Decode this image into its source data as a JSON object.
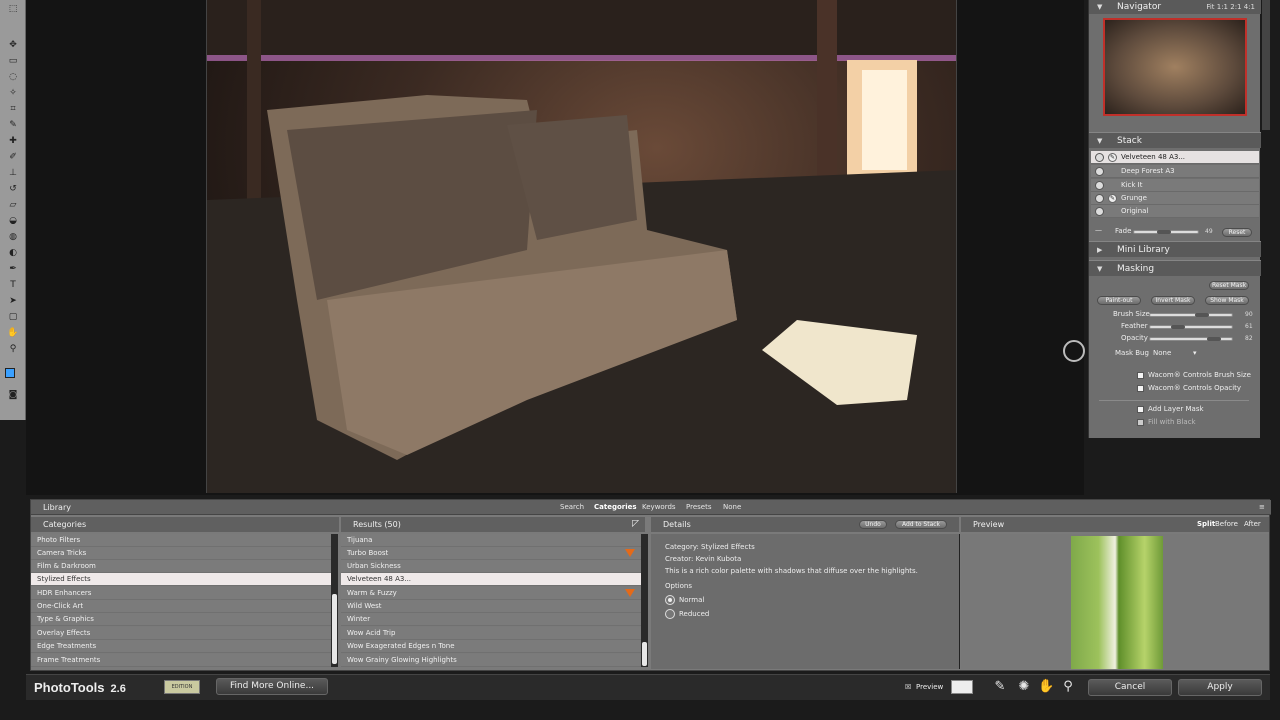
{
  "app": {
    "name": "PhotoTools",
    "version": "2.6",
    "edition_badge": "EDITION"
  },
  "navigator": {
    "title": "Navigator",
    "zoom_options": "Fit  1:1  2:1  4:1"
  },
  "stack": {
    "title": "Stack",
    "items": [
      {
        "label": "Velveteen 48 A3..."
      },
      {
        "label": "Deep Forest A3"
      },
      {
        "label": "Kick It"
      },
      {
        "label": "Grunge"
      },
      {
        "label": "Original"
      }
    ],
    "fade_label": "Fade",
    "fade_value": "49",
    "reset_label": "Reset"
  },
  "mini_library": {
    "title": "Mini Library"
  },
  "masking": {
    "title": "Masking",
    "reset_mask": "Reset Mask",
    "paint_out": "Paint-out",
    "invert_mask": "Invert Mask",
    "show_mask": "Show Mask",
    "brush_size_label": "Brush Size",
    "brush_size_value": "90",
    "feather_label": "Feather",
    "feather_value": "61",
    "opacity_label": "Opacity",
    "opacity_value": "82",
    "mask_bug_label": "Mask Bug",
    "mask_bug_value": "None",
    "wacom_brush": "Wacom® Controls Brush Size",
    "wacom_opacity": "Wacom® Controls Opacity",
    "add_layer_mask": "Add Layer Mask",
    "fill_black": "Fill with Black"
  },
  "library": {
    "title": "Library",
    "tabs": [
      "Search",
      "Categories",
      "Keywords",
      "Presets",
      "None"
    ],
    "categories_header": "Categories",
    "categories": [
      "Photo Filters",
      "Camera Tricks",
      "Film & Darkroom",
      "Stylized Effects",
      "HDR Enhancers",
      "One-Click Art",
      "Type & Graphics",
      "Overlay Effects",
      "Edge Treatments",
      "Frame Treatments"
    ],
    "results_header": "Results (50)",
    "results": [
      "Tijuana",
      "Turbo Boost",
      "Urban Sickness",
      "Velveteen 48 A3...",
      "Warm & Fuzzy",
      "Wild West",
      "Winter",
      "Wow Acid Trip",
      "Wow Exagerated Edges n Tone",
      "Wow Grainy Glowing Highlights"
    ],
    "details_header": "Details",
    "undo_label": "Undo",
    "add_to_stack_label": "Add to Stack",
    "category_line": "Category:  Stylized Effects",
    "creator_line": "Creator:    Kevin Kubota",
    "description": "This is a rich color palette with shadows that diffuse over the highlights.",
    "options_label": "Options",
    "option_normal": "Normal",
    "option_reduced": "Reduced",
    "preview_header": "Preview",
    "preview_modes": [
      "Split",
      "Before",
      "After"
    ]
  },
  "bottom_bar": {
    "find_more": "Find More Online...",
    "preview_label": "Preview",
    "cancel_label": "Cancel",
    "apply_label": "Apply"
  }
}
